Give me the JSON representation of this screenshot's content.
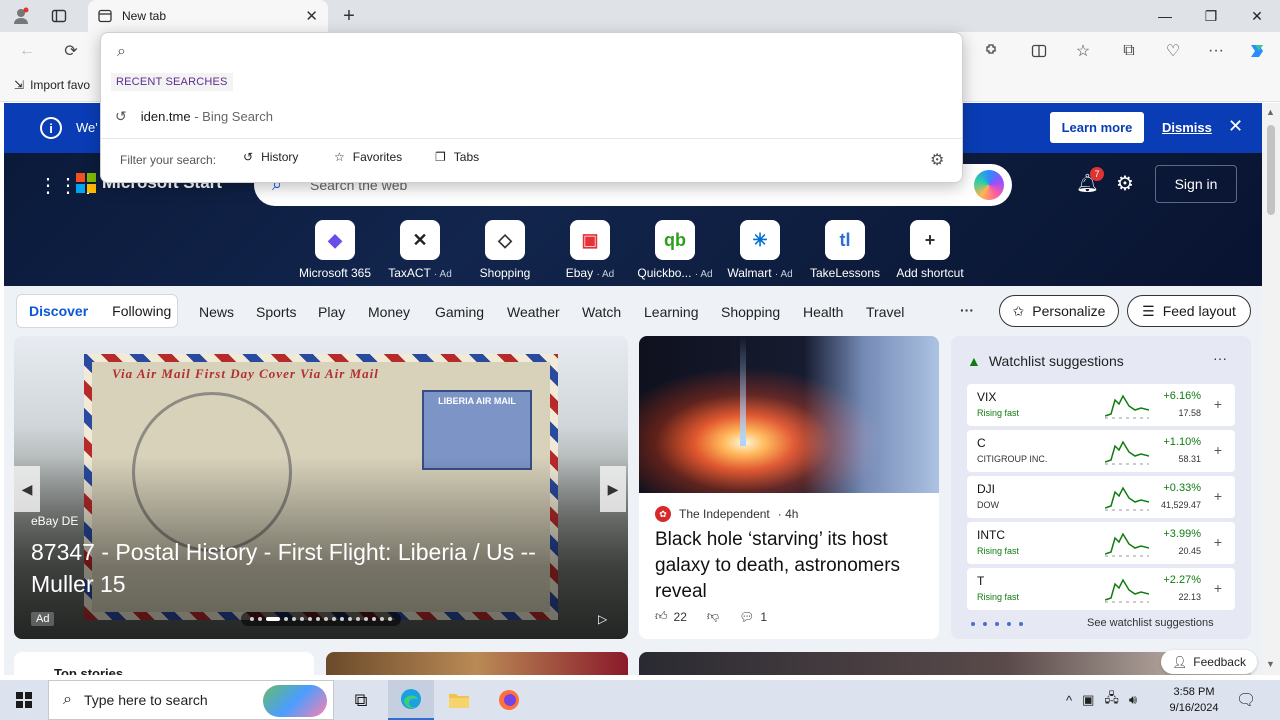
{
  "window": {
    "tab_title": "New tab"
  },
  "favbar": {
    "import_label": "Import favo"
  },
  "omnibox": {
    "recent_label": "RECENT SEARCHES",
    "recent_query": "iden.tme",
    "recent_engine": "- Bing Search",
    "filter_label": "Filter your search:",
    "filters": [
      "History",
      "Favorites",
      "Tabs"
    ]
  },
  "banner": {
    "text": "We'",
    "learn_more": "Learn more",
    "dismiss": "Dismiss"
  },
  "hero": {
    "brand": "Microsoft Start",
    "search_placeholder": "Search the web",
    "notif_count": "7",
    "signin": "Sign in",
    "shortcuts": [
      {
        "label": "Microsoft 365",
        "ad": "",
        "color": "#6b4ce6",
        "glyph": "◆"
      },
      {
        "label": "TaxACT",
        "ad": "· Ad",
        "color": "#222222",
        "glyph": "✕"
      },
      {
        "label": "Shopping",
        "ad": "",
        "color": "#333333",
        "glyph": "◇"
      },
      {
        "label": "Ebay",
        "ad": "· Ad",
        "color": "#e53238",
        "glyph": "▣"
      },
      {
        "label": "Quickbo...",
        "ad": "· Ad",
        "color": "#2ca01c",
        "glyph": "qb"
      },
      {
        "label": "Walmart",
        "ad": "· Ad",
        "color": "#0071ce",
        "glyph": "✳"
      },
      {
        "label": "TakeLessons",
        "ad": "",
        "color": "#2b6fd6",
        "glyph": "tl"
      },
      {
        "label": "Add shortcut",
        "ad": "",
        "color": "#333333",
        "glyph": "+"
      }
    ]
  },
  "feednav": {
    "discover": "Discover",
    "following": "Following",
    "tabs": [
      "News",
      "Sports",
      "Play",
      "Money",
      "Gaming",
      "Weather",
      "Watch",
      "Learning",
      "Shopping",
      "Health",
      "Travel"
    ],
    "more": "···",
    "personalize": "Personalize",
    "feed_layout": "Feed layout"
  },
  "big_card": {
    "source": "eBay DE",
    "headline": "87347 - Postal History - First Flight: Liberia / Us -- Muller 15",
    "ad": "Ad",
    "stamp_text": "Via Air Mail   First Day Cover   Via Air Mail",
    "air_stamp": "LIBERIA AIR MAIL"
  },
  "news_card": {
    "publisher": "The Independent",
    "age": "· 4h",
    "title": "Black hole ‘starving’ its host galaxy to death, astronomers reveal",
    "likes": "22",
    "comments": "1"
  },
  "watchlist": {
    "title": "Watchlist suggestions",
    "more": "···",
    "see_all": "See watchlist suggestions",
    "stocks": [
      {
        "symbol": "VIX",
        "sub": "Rising fast",
        "change": "+6.16%",
        "price": "17.58",
        "fast": true
      },
      {
        "symbol": "C",
        "sub": "CITIGROUP INC.",
        "change": "+1.10%",
        "price": "58.31",
        "fast": false
      },
      {
        "symbol": "DJI",
        "sub": "DOW",
        "change": "+0.33%",
        "price": "41,529.47",
        "fast": false
      },
      {
        "symbol": "INTC",
        "sub": "Rising fast",
        "change": "+3.99%",
        "price": "20.45",
        "fast": true
      },
      {
        "symbol": "T",
        "sub": "Rising fast",
        "change": "+2.27%",
        "price": "22.13",
        "fast": true
      }
    ]
  },
  "bottom": {
    "top_stories": "Top stories",
    "feedback": "Feedback"
  },
  "taskbar": {
    "search_placeholder": "Type here to search",
    "time": "3:58 PM",
    "date": "9/16/2024"
  }
}
